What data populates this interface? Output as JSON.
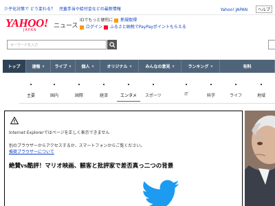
{
  "topbar": {
    "links": [
      "少子化対策で どう変わる？",
      "児童手当や給付金などの最新情報"
    ],
    "right_links": [
      "Yahoo! JAPAN",
      "ヘルプ"
    ]
  },
  "header": {
    "logo_text": "YAHOO!",
    "logo_sub": "JAPAN",
    "service_name": "ニュース",
    "login_line1": "IDでもっと便利に",
    "login_link1": "新規取得",
    "login_line2_link": "ログイン",
    "promo_text": "ふるさと納税でPayPayポイントもらえる"
  },
  "search": {
    "placeholder": "キーワードを入力"
  },
  "nav": {
    "items": [
      {
        "label": "トップ",
        "arrow": false,
        "active": true
      },
      {
        "label": "速報",
        "arrow": true
      },
      {
        "label": "ライブ",
        "arrow": true
      },
      {
        "label": "個人",
        "arrow": true
      },
      {
        "label": "オリジナル",
        "arrow": true
      },
      {
        "label": "みんなの意見",
        "arrow": true
      },
      {
        "label": "ランキング",
        "arrow": true
      },
      {
        "label": "有料",
        "arrow": false
      }
    ]
  },
  "subtabs": {
    "items": [
      "主要",
      "国内",
      "国際",
      "経済",
      "エンタメ",
      "スポーツ",
      "IT",
      "科学",
      "ライフ",
      "地域"
    ],
    "active": "エンタメ"
  },
  "article": {
    "warning_line": "Internet Explorerではページを正しく表示できません",
    "browser_line": "別のブラウザーからアクセスするか、スマートフォンからご覧ください。",
    "browser_link": "推奨ブラウザーについて",
    "headline": "絶賛vs酷評！マリオ映画、観客と批評家で差否真っ二つの背景"
  },
  "colors": {
    "nav_bg": "#4f6479",
    "brand_red": "#ff0033",
    "twitter_blue": "#1d9bf0"
  }
}
